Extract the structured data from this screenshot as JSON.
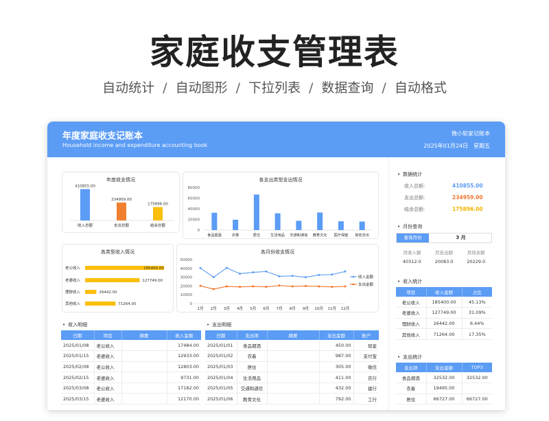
{
  "hero": {
    "title": "家庭收支管理表",
    "features": [
      "自动统计",
      "自动图形",
      "下拉列表",
      "数据查询",
      "自动格式"
    ]
  },
  "header": {
    "title": "年度家庭收支记账本",
    "subtitle": "Household income and expenditure accounting book",
    "author": "微小软家记账本",
    "date": "2025年01月24日",
    "weekday": "星期五"
  },
  "colors": {
    "accent": "#5b9cf5",
    "orange": "#f08030",
    "yellow": "#fbbf10",
    "income": "#5b9cf5",
    "expense": "#f0742a",
    "balance": "#f5b400"
  },
  "chart_data": [
    {
      "type": "bar",
      "title": "年度收支情况",
      "categories": [
        "收入总额",
        "支出总额",
        "结余总额"
      ],
      "values": [
        410855.0,
        234959.0,
        175896.0
      ],
      "value_labels": [
        "410855.00",
        "234959.00",
        "175896.00"
      ],
      "ylim": [
        0,
        450000
      ]
    },
    {
      "type": "bar",
      "title": "各支出类型支出情况",
      "categories": [
        "食品烟酒",
        "衣着",
        "居住",
        "生活用品",
        "交通和通信",
        "教育文化",
        "医疗保健",
        "其他支出"
      ],
      "values": [
        32532,
        19495,
        66727,
        31500,
        17500,
        33000,
        16500,
        16000
      ],
      "yticks": [
        "80000",
        "60000",
        "40000",
        "20000",
        "0"
      ],
      "ylim": [
        0,
        80000
      ]
    },
    {
      "type": "bar",
      "title": "各类型收入情况",
      "orientation": "horizontal",
      "categories": [
        "老公收入",
        "老婆收入",
        "理财收入",
        "其他收入"
      ],
      "values": [
        185400.0,
        127749.0,
        26442.0,
        71264.0
      ],
      "value_labels": [
        "185400.00",
        "127749.00",
        "26442.00",
        "71264.00"
      ],
      "xlim": [
        0,
        190000
      ]
    },
    {
      "type": "line",
      "title": "各月份收支情况",
      "categories": [
        "1月",
        "2月",
        "3月",
        "4月",
        "5月",
        "6月",
        "7月",
        "8月",
        "9月",
        "10月",
        "11月",
        "12月"
      ],
      "series": [
        {
          "name": "收入金额",
          "values": [
            40312,
            30000,
            40500,
            34000,
            35500,
            36500,
            31000,
            31500,
            30000,
            32500,
            33000,
            36500
          ]
        },
        {
          "name": "支出金额",
          "values": [
            20083,
            16500,
            19500,
            19000,
            19500,
            19000,
            20500,
            19500,
            20000,
            19500,
            19000,
            19500
          ]
        }
      ],
      "yticks": [
        "50000",
        "40000",
        "30000",
        "20000",
        "10000",
        "0"
      ],
      "ylim": [
        0,
        50000
      ],
      "legend": "right"
    }
  ],
  "income_detail": {
    "label": "收入明细",
    "columns": [
      "日期",
      "项目",
      "摘要",
      "收入金额"
    ],
    "rows": [
      [
        "2025/01/08",
        "老公收入",
        "",
        "17484.00"
      ],
      [
        "2025/01/15",
        "老婆收入",
        "",
        "12933.00"
      ],
      [
        "2025/02/08",
        "老公收入",
        "",
        "12803.00"
      ],
      [
        "2025/02/15",
        "老婆收入",
        "",
        "9731.00"
      ],
      [
        "2025/03/08",
        "老公收入",
        "",
        "17182.00"
      ],
      [
        "2025/03/15",
        "老婆收入",
        "",
        "12170.00"
      ]
    ]
  },
  "expense_detail": {
    "label": "支出明细",
    "columns": [
      "日期",
      "支出项",
      "摘要",
      "支出金额",
      "账户"
    ],
    "rows": [
      [
        "2025/01/01",
        "食品烟酒",
        "",
        "450.00",
        "现金"
      ],
      [
        "2025/01/02",
        "衣着",
        "",
        "987.00",
        "支付宝"
      ],
      [
        "2025/01/03",
        "居住",
        "",
        "305.00",
        "微信"
      ],
      [
        "2025/01/04",
        "生活用品",
        "",
        "411.00",
        "农行"
      ],
      [
        "2025/01/05",
        "交通和通信",
        "",
        "432.00",
        "建行"
      ],
      [
        "2025/01/06",
        "教育文化",
        "",
        "792.00",
        "工行"
      ]
    ]
  },
  "stats": {
    "label": "数据统计",
    "items": [
      {
        "k": "收入总额:",
        "v": "410855.00"
      },
      {
        "k": "支出总额:",
        "v": "234959.00"
      },
      {
        "k": "结余总额:",
        "v": "175896.00"
      }
    ]
  },
  "month_query": {
    "label": "月份查询",
    "button": "查询月份",
    "value": "3 月",
    "headers": [
      "月收入额",
      "月支出额",
      "月结余额"
    ],
    "values": [
      "40312.0",
      "20083.0",
      "20229.0"
    ]
  },
  "income_stats": {
    "label": "收入统计",
    "columns": [
      "项目",
      "收入金额",
      "占比"
    ],
    "rows": [
      [
        "老公收入",
        "185400.00",
        "45.13%"
      ],
      [
        "老婆收入",
        "127749.00",
        "31.09%"
      ],
      [
        "理财收入",
        "26442.00",
        "6.44%"
      ],
      [
        "其他收入",
        "71264.00",
        "17.35%"
      ]
    ]
  },
  "expense_stats": {
    "label": "支出统计",
    "columns": [
      "支出项",
      "支出金额",
      "TOP3"
    ],
    "rows": [
      [
        "食品烟酒",
        "32532.00",
        "32532.00"
      ],
      [
        "衣着",
        "19495.00",
        ""
      ],
      [
        "居住",
        "66727.00",
        "66727.00"
      ]
    ]
  }
}
